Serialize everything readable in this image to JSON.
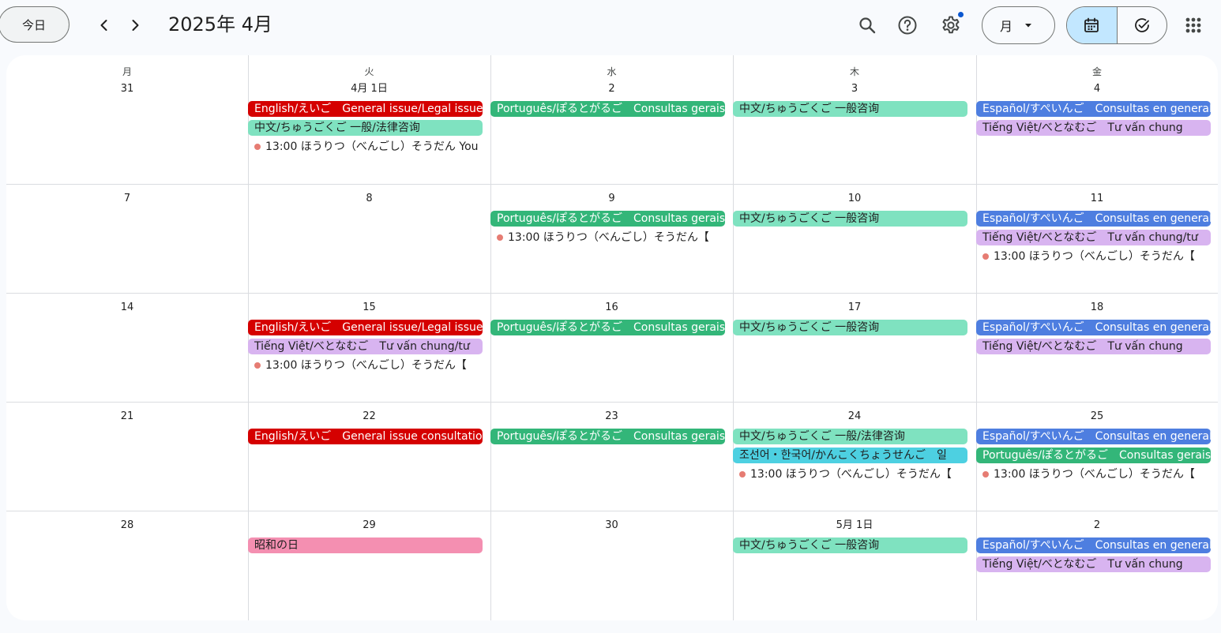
{
  "toolbar": {
    "today_label": "今日",
    "title": "2025年 4月",
    "view_label": "月",
    "icons": {
      "prev": "chevron-left-icon",
      "next": "chevron-right-icon",
      "search": "search-icon",
      "help": "help-icon",
      "settings": "gear-icon",
      "dropdown": "caret-down-icon",
      "calendar": "calendar-icon",
      "tasks": "task-check-icon",
      "apps": "apps-grid-icon"
    }
  },
  "colors": {
    "red": "#d50000",
    "green": "#33b679",
    "mint": "#7fe2c0",
    "blue": "#4e7ee0",
    "lavender": "#d8b4f0",
    "cyan": "#4dd0e1",
    "pink": "#f48fb1",
    "dot": "#e67c73",
    "accent": "#0b57d0"
  },
  "calendar": {
    "weekdays": [
      "月",
      "火",
      "水",
      "木",
      "金"
    ],
    "weeks": [
      {
        "days": [
          {
            "label": "31",
            "events": []
          },
          {
            "label": "4月 1日",
            "events": [
              {
                "text": "English/えいご　General issue/Legal issue",
                "color": "red"
              },
              {
                "text": "中文/ちゅうごくご 一般/法律咨询",
                "color": "mint"
              },
              {
                "text": "13:00 ほうりつ（べんごし）そうだん You",
                "timed": true
              }
            ]
          },
          {
            "label": "2",
            "events": [
              {
                "text": "Português/ぽるとがるご　Consultas gerais",
                "color": "green"
              }
            ]
          },
          {
            "label": "3",
            "events": [
              {
                "text": "中文/ちゅうごくご 一般咨询",
                "color": "mint"
              }
            ]
          },
          {
            "label": "4",
            "events": [
              {
                "text": "Español/すぺいんご　Consultas en general",
                "color": "blue"
              },
              {
                "text": "Tiếng Việt/べとなむご　Tư vấn chung",
                "color": "lavender"
              }
            ]
          }
        ]
      },
      {
        "days": [
          {
            "label": "7",
            "events": []
          },
          {
            "label": "8",
            "events": []
          },
          {
            "label": "9",
            "events": [
              {
                "text": "Português/ぽるとがるご　Consultas gerais",
                "color": "green"
              },
              {
                "text": "13:00 ほうりつ（べんごし）そうだん【",
                "timed": true
              }
            ]
          },
          {
            "label": "10",
            "events": [
              {
                "text": "中文/ちゅうごくご 一般咨询",
                "color": "mint"
              }
            ]
          },
          {
            "label": "11",
            "events": [
              {
                "text": "Español/すぺいんご　Consultas en general",
                "color": "blue"
              },
              {
                "text": "Tiếng Việt/べとなむご　Tư vấn chung/tư",
                "color": "lavender"
              },
              {
                "text": "13:00 ほうりつ（べんごし）そうだん【",
                "timed": true
              }
            ]
          }
        ]
      },
      {
        "days": [
          {
            "label": "14",
            "events": []
          },
          {
            "label": "15",
            "events": [
              {
                "text": "English/えいご　General issue/Legal issue",
                "color": "red"
              },
              {
                "text": "Tiếng Việt/べとなむご　Tư vấn chung/tư",
                "color": "lavender"
              },
              {
                "text": "13:00 ほうりつ（べんごし）そうだん【",
                "timed": true
              }
            ]
          },
          {
            "label": "16",
            "events": [
              {
                "text": "Português/ぽるとがるご　Consultas gerais",
                "color": "green"
              }
            ]
          },
          {
            "label": "17",
            "events": [
              {
                "text": "中文/ちゅうごくご 一般咨询",
                "color": "mint"
              }
            ]
          },
          {
            "label": "18",
            "events": [
              {
                "text": "Español/すぺいんご　Consultas en general",
                "color": "blue"
              },
              {
                "text": "Tiếng Việt/べとなむご　Tư vấn chung",
                "color": "lavender"
              }
            ]
          }
        ]
      },
      {
        "days": [
          {
            "label": "21",
            "events": []
          },
          {
            "label": "22",
            "events": [
              {
                "text": "English/えいご　General issue consultation",
                "color": "red"
              }
            ]
          },
          {
            "label": "23",
            "events": [
              {
                "text": "Português/ぽるとがるご　Consultas gerais",
                "color": "green"
              }
            ]
          },
          {
            "label": "24",
            "events": [
              {
                "text": "中文/ちゅうごくご 一般/法律咨询",
                "color": "mint"
              },
              {
                "text": "조선어・한국어/かんこくちょうせんご　일",
                "color": "cyan"
              },
              {
                "text": "13:00 ほうりつ（べんごし）そうだん【",
                "timed": true
              }
            ]
          },
          {
            "label": "25",
            "events": [
              {
                "text": "Español/すぺいんご　Consultas en general",
                "color": "blue"
              },
              {
                "text": "Português/ぽるとがるご　Consultas gerais",
                "color": "green"
              },
              {
                "text": "13:00 ほうりつ（べんごし）そうだん【",
                "timed": true
              }
            ]
          }
        ]
      },
      {
        "days": [
          {
            "label": "28",
            "events": []
          },
          {
            "label": "29",
            "events": [
              {
                "text": "昭和の日",
                "color": "pink"
              }
            ]
          },
          {
            "label": "30",
            "events": []
          },
          {
            "label": "5月 1日",
            "events": [
              {
                "text": "中文/ちゅうごくご 一般咨询",
                "color": "mint"
              }
            ]
          },
          {
            "label": "2",
            "events": [
              {
                "text": "Español/すぺいんご　Consultas en general",
                "color": "blue"
              },
              {
                "text": "Tiếng Việt/べとなむご　Tư vấn chung",
                "color": "lavender"
              }
            ]
          }
        ]
      }
    ]
  }
}
